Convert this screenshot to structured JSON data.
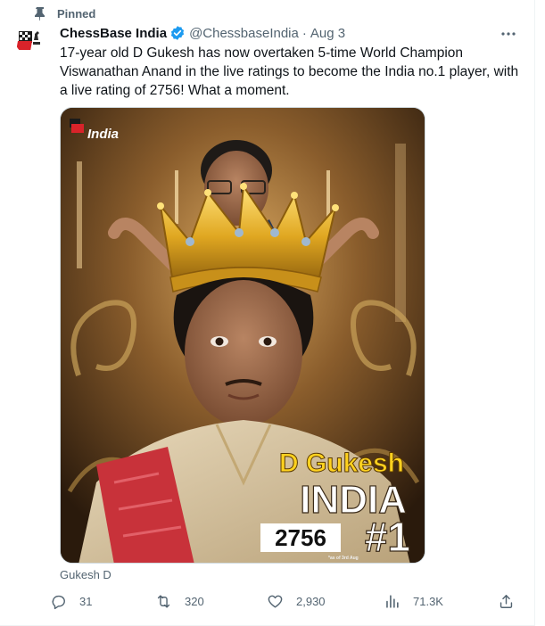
{
  "pinned": {
    "label": "Pinned",
    "icon": "pin-icon"
  },
  "author": {
    "name": "ChessBase India",
    "handle": "@ChessbaseIndia",
    "separator": "·",
    "date": "Aug 3",
    "verified": true
  },
  "tweet": {
    "text": "17-year old D Gukesh has now overtaken 5-time World Champion Viswanathan Anand in the live ratings to become the India no.1 player, with a live rating of 2756! What a moment."
  },
  "media": {
    "logo_text": "India",
    "headline_name": "D Gukesh",
    "headline_country": "INDIA",
    "rating": "2756",
    "rank": "#1",
    "footnote": "*as of 3rd Aug",
    "tagged": "Gukesh D"
  },
  "actions": {
    "replies": "31",
    "retweets": "320",
    "likes": "2,930",
    "views": "71.3K"
  },
  "colors": {
    "text": "#0f1419",
    "secondary": "#536471",
    "verified": "#1d9bf0",
    "headline_yellow": "#ffd21f"
  }
}
